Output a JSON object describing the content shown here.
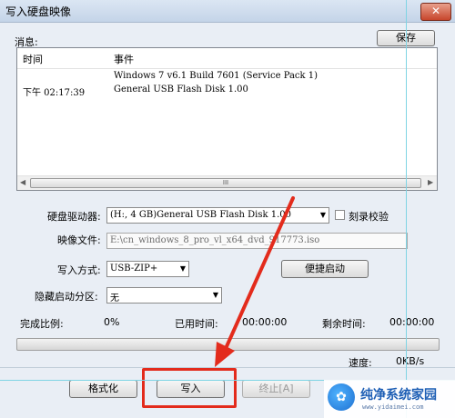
{
  "window": {
    "title": "写入硬盘映像",
    "close_label": "✕"
  },
  "messages": {
    "label": "消息:",
    "save_button": "保存",
    "columns": [
      "时间",
      "事件"
    ],
    "rows": [
      {
        "time": "",
        "event": "Windows 7 v6.1 Build 7601 (Service Pack 1)"
      },
      {
        "time": "下午 02:17:39",
        "event": "General USB Flash Disk  1.00"
      }
    ],
    "scroll_grip": "III"
  },
  "drive": {
    "label": "硬盘驱动器:",
    "value": "(H:, 4 GB)General USB Flash Disk  1.00",
    "verify_label": "刻录校验",
    "verify_checked": false
  },
  "image_file": {
    "label": "映像文件:",
    "value": "E:\\cn_windows_8_pro_vl_x64_dvd_917773.iso"
  },
  "write_mode": {
    "label": "写入方式:",
    "value": "USB-ZIP+",
    "boot_button": "便捷启动"
  },
  "hidden_partition": {
    "label": "隐藏启动分区:",
    "value": "无"
  },
  "status": {
    "completion_label": "完成比例:",
    "completion_value": "0%",
    "elapsed_label": "已用时间:",
    "elapsed_value": "00:00:00",
    "remaining_label": "剩余时间:",
    "remaining_value": "00:00:00",
    "speed_label": "速度:",
    "speed_value": "0KB/s",
    "progress": 0
  },
  "actions": {
    "format": "格式化",
    "write": "写入",
    "stop": "终止[A]"
  },
  "watermark": {
    "name": "纯净系统家园",
    "url": "www.yidaimei.com"
  },
  "colors": {
    "highlight": "#e32b1c",
    "arrow": "#e32b1c",
    "guide": "#7fd4e4"
  },
  "icons": {
    "close": "close-icon",
    "dropdown": "chevron-down-icon",
    "scroll_left": "arrow-left-icon",
    "scroll_right": "arrow-right-icon"
  }
}
